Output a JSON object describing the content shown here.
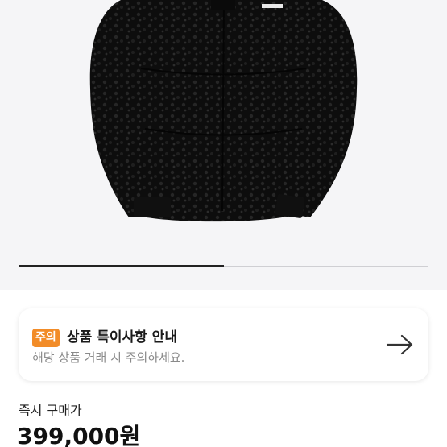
{
  "product": {
    "image_alt": "black fleece puffer jacket",
    "carousel_progress": 0.5
  },
  "notice": {
    "badge": "주의",
    "title": "상품 특이사항 안내",
    "description": "해당 상품 거래 시 주의하세요.",
    "arrow_icon": "arrow-right-icon"
  },
  "price": {
    "label": "즉시 구매가",
    "value": "399,000원"
  },
  "colors": {
    "badge": "#f28c28",
    "background": "#f5f5f7"
  }
}
